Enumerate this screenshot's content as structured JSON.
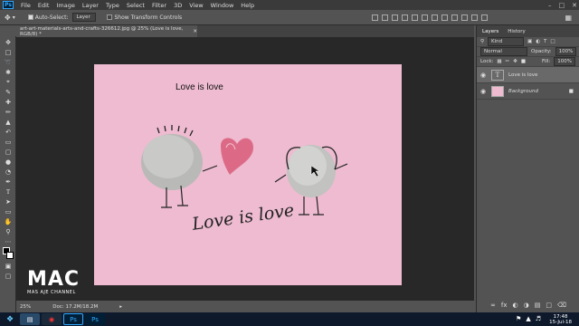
{
  "menubar": {
    "logo": "Ps",
    "items": [
      "File",
      "Edit",
      "Image",
      "Layer",
      "Type",
      "Select",
      "Filter",
      "3D",
      "View",
      "Window",
      "Help"
    ]
  },
  "options": {
    "auto_select_label": "Auto-Select:",
    "auto_select_value": "Layer",
    "transform_label": "Show Transform Controls"
  },
  "document": {
    "tab_title": "art-art-materials-arts-and-crafts-326612.jpg @ 25% (Love is love, RGB/8) *"
  },
  "canvas": {
    "text_top": "Love is love",
    "text_script": "Love is love"
  },
  "status": {
    "zoom": "25%",
    "doc_size": "Doc: 17.2M/18.2M"
  },
  "layers_panel": {
    "tabs": [
      "Layers",
      "History"
    ],
    "kind_label": "Kind",
    "blend_mode": "Normal",
    "opacity_label": "Opacity:",
    "opacity_value": "100%",
    "lock_label": "Lock:",
    "fill_label": "Fill:",
    "fill_value": "100%",
    "layers": [
      {
        "name": "Love is love",
        "type": "text",
        "selected": true
      },
      {
        "name": "Background",
        "type": "image",
        "selected": false
      }
    ]
  },
  "taskbar": {
    "time": "17:48",
    "date": "15-Jul-18",
    "apps": [
      "Explorer",
      "Chrome",
      "Ps",
      "Ps"
    ]
  },
  "watermark": {
    "main": "MAC",
    "sub": "MAS AJE CHANNEL"
  },
  "colors": {
    "canvas_bg": "#eebbd0",
    "ps_blue": "#31a8ff"
  }
}
